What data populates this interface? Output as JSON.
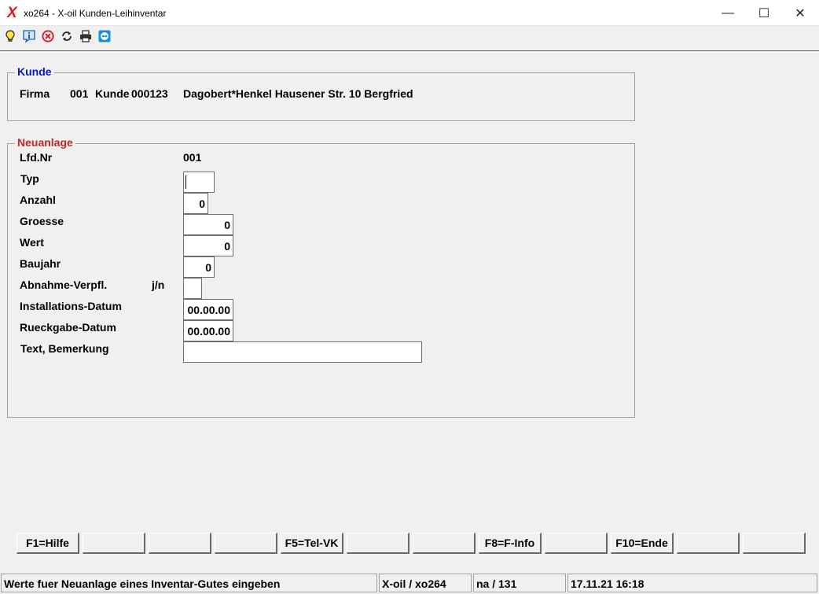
{
  "window": {
    "title": "xo264 - X-oil Kunden-Leihinventar",
    "app_icon_glyph": "X",
    "controls": {
      "minimize": "—",
      "maximize": "☐",
      "close": "✕"
    }
  },
  "toolbar": {
    "icons": [
      "lightbulb-icon",
      "info-icon",
      "cancel-icon",
      "refresh-icon",
      "print-icon",
      "teamviewer-icon"
    ]
  },
  "kunde": {
    "legend": "Kunde",
    "firma_label": "Firma",
    "firma_nr": "001",
    "kunde_label": "Kunde",
    "kunde_nr": "000123",
    "kunde_name": "Dagobert*Henkel Hausener Str. 10 Bergfried"
  },
  "neuanlage": {
    "legend": "Neuanlage",
    "lfd_nr_label": "Lfd.Nr",
    "lfd_nr_value": "001",
    "typ_label": "Typ",
    "typ_value": "",
    "anzahl_label": "Anzahl",
    "anzahl_value": "0",
    "groesse_label": "Groesse",
    "groesse_value": "0",
    "wert_label": "Wert",
    "wert_value": "0",
    "baujahr_label": "Baujahr",
    "baujahr_value": "0",
    "abnahme_label": "Abnahme-Verpfl.",
    "abnahme_hint": "j/n",
    "abnahme_value": "",
    "installation_label": "Installations-Datum",
    "installation_value": "00.00.00",
    "rueckgabe_label": "Rueckgabe-Datum",
    "rueckgabe_value": "00.00.00",
    "text_label": "Text, Bemerkung",
    "text_value": ""
  },
  "fkeys": [
    "F1=Hilfe",
    "",
    "",
    "",
    "F5=Tel-VK",
    "",
    "",
    "F8=F-Info",
    "",
    "F10=Ende",
    "",
    ""
  ],
  "status": {
    "message": "Werte fuer Neuanlage eines Inventar-Gutes eingeben",
    "program": "X-oil / xo264",
    "user": "na / 131",
    "datetime": "17.11.21 16:18"
  },
  "colors": {
    "kunde_legend": "#0a14c8",
    "neuanlage_legend": "#c0281e",
    "close_icon_red": "#e81123"
  }
}
